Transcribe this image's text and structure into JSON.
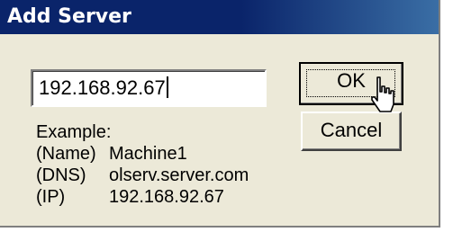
{
  "dialog": {
    "title": "Add Server",
    "input_value": "192.168.92.67",
    "ok_label": "OK",
    "cancel_label": "Cancel",
    "example_heading": "Example:",
    "examples": [
      {
        "key": "(Name)",
        "value": "Machine1"
      },
      {
        "key": "(DNS)",
        "value": "olserv.server.com"
      },
      {
        "key": "(IP)",
        "value": "192.168.92.67"
      }
    ]
  },
  "icons": {
    "cursor": "hand-pointer-icon"
  }
}
